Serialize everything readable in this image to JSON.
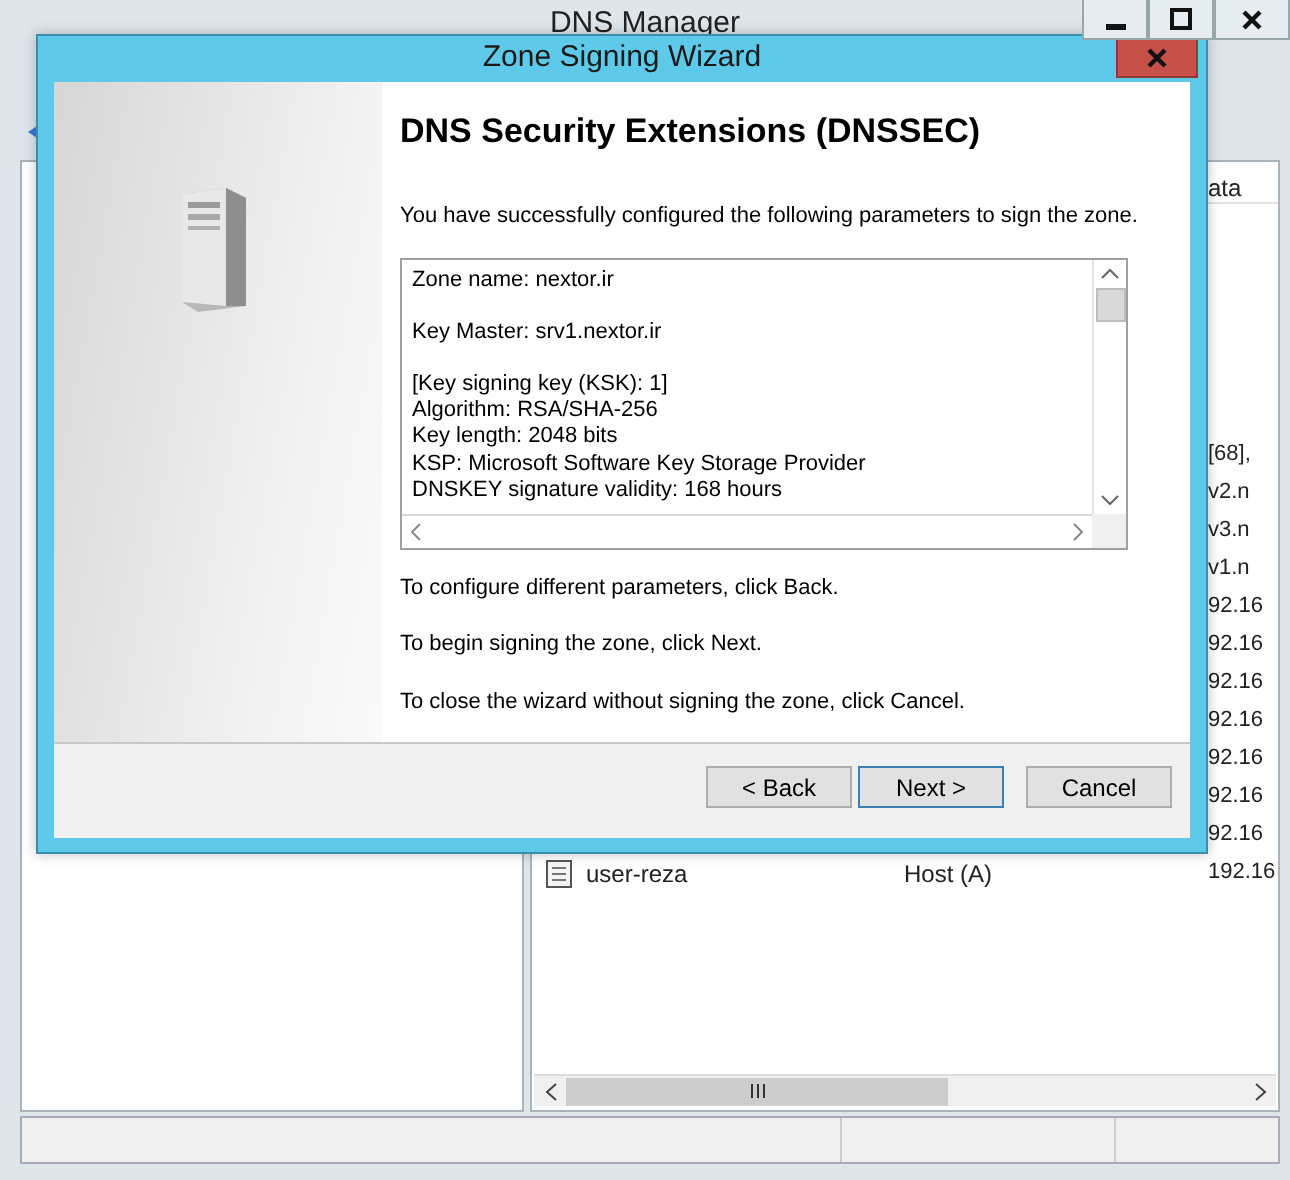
{
  "main_window": {
    "title": "DNS Manager",
    "records": {
      "column_header": "ata",
      "rows": [
        {
          "data": "[68],"
        },
        {
          "data": "v2.n"
        },
        {
          "data": "v3.n"
        },
        {
          "data": "v1.n"
        },
        {
          "data": "92.16"
        },
        {
          "data": "92.16"
        },
        {
          "data": "92.16"
        },
        {
          "data": "92.16"
        },
        {
          "data": "92.16"
        },
        {
          "data": "92.16"
        },
        {
          "data": "92.16"
        },
        {
          "name": "user-reza",
          "type": "Host (A)",
          "data": "192.16"
        }
      ]
    }
  },
  "wizard": {
    "title": "Zone Signing Wizard",
    "heading": "DNS Security Extensions (DNSSEC)",
    "intro": "You have successfully configured the following parameters to sign the zone.",
    "summary": [
      [
        "Zone name: nextor.ir"
      ],
      [
        "Key Master: srv1.nextor.ir"
      ],
      [
        "[Key signing key (KSK): 1]",
        "Algorithm: RSA/SHA-256",
        "Key length: 2048 bits",
        "KSP: Microsoft Software Key Storage Provider",
        "DNSKEY signature validity: 168 hours"
      ]
    ],
    "notes": [
      "To configure different parameters, click Back.",
      "To begin signing the zone, click Next.",
      "To close the wizard without signing the zone, click Cancel."
    ],
    "buttons": [
      {
        "label": "< Back",
        "default": false
      },
      {
        "label": "Next >",
        "default": true
      },
      {
        "label": "Cancel",
        "default": false
      }
    ]
  }
}
